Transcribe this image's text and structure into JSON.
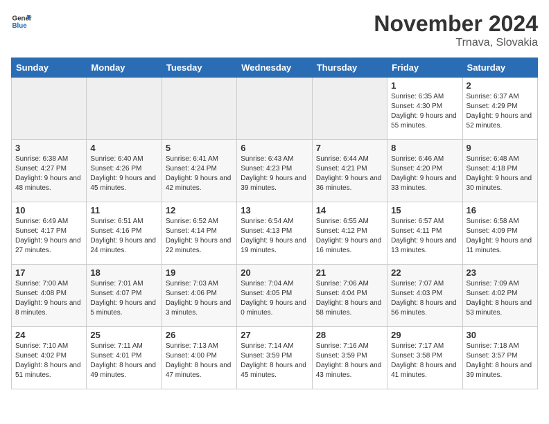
{
  "header": {
    "logo_line1": "General",
    "logo_line2": "Blue",
    "month_title": "November 2024",
    "location": "Trnava, Slovakia"
  },
  "weekdays": [
    "Sunday",
    "Monday",
    "Tuesday",
    "Wednesday",
    "Thursday",
    "Friday",
    "Saturday"
  ],
  "weeks": [
    {
      "days": [
        {
          "num": "",
          "empty": true
        },
        {
          "num": "",
          "empty": true
        },
        {
          "num": "",
          "empty": true
        },
        {
          "num": "",
          "empty": true
        },
        {
          "num": "",
          "empty": true
        },
        {
          "num": "1",
          "sunrise": "6:35 AM",
          "sunset": "4:30 PM",
          "daylight": "9 hours and 55 minutes."
        },
        {
          "num": "2",
          "sunrise": "6:37 AM",
          "sunset": "4:29 PM",
          "daylight": "9 hours and 52 minutes."
        }
      ]
    },
    {
      "days": [
        {
          "num": "3",
          "sunrise": "6:38 AM",
          "sunset": "4:27 PM",
          "daylight": "9 hours and 48 minutes."
        },
        {
          "num": "4",
          "sunrise": "6:40 AM",
          "sunset": "4:26 PM",
          "daylight": "9 hours and 45 minutes."
        },
        {
          "num": "5",
          "sunrise": "6:41 AM",
          "sunset": "4:24 PM",
          "daylight": "9 hours and 42 minutes."
        },
        {
          "num": "6",
          "sunrise": "6:43 AM",
          "sunset": "4:23 PM",
          "daylight": "9 hours and 39 minutes."
        },
        {
          "num": "7",
          "sunrise": "6:44 AM",
          "sunset": "4:21 PM",
          "daylight": "9 hours and 36 minutes."
        },
        {
          "num": "8",
          "sunrise": "6:46 AM",
          "sunset": "4:20 PM",
          "daylight": "9 hours and 33 minutes."
        },
        {
          "num": "9",
          "sunrise": "6:48 AM",
          "sunset": "4:18 PM",
          "daylight": "9 hours and 30 minutes."
        }
      ]
    },
    {
      "days": [
        {
          "num": "10",
          "sunrise": "6:49 AM",
          "sunset": "4:17 PM",
          "daylight": "9 hours and 27 minutes."
        },
        {
          "num": "11",
          "sunrise": "6:51 AM",
          "sunset": "4:16 PM",
          "daylight": "9 hours and 24 minutes."
        },
        {
          "num": "12",
          "sunrise": "6:52 AM",
          "sunset": "4:14 PM",
          "daylight": "9 hours and 22 minutes."
        },
        {
          "num": "13",
          "sunrise": "6:54 AM",
          "sunset": "4:13 PM",
          "daylight": "9 hours and 19 minutes."
        },
        {
          "num": "14",
          "sunrise": "6:55 AM",
          "sunset": "4:12 PM",
          "daylight": "9 hours and 16 minutes."
        },
        {
          "num": "15",
          "sunrise": "6:57 AM",
          "sunset": "4:11 PM",
          "daylight": "9 hours and 13 minutes."
        },
        {
          "num": "16",
          "sunrise": "6:58 AM",
          "sunset": "4:09 PM",
          "daylight": "9 hours and 11 minutes."
        }
      ]
    },
    {
      "days": [
        {
          "num": "17",
          "sunrise": "7:00 AM",
          "sunset": "4:08 PM",
          "daylight": "9 hours and 8 minutes."
        },
        {
          "num": "18",
          "sunrise": "7:01 AM",
          "sunset": "4:07 PM",
          "daylight": "9 hours and 5 minutes."
        },
        {
          "num": "19",
          "sunrise": "7:03 AM",
          "sunset": "4:06 PM",
          "daylight": "9 hours and 3 minutes."
        },
        {
          "num": "20",
          "sunrise": "7:04 AM",
          "sunset": "4:05 PM",
          "daylight": "9 hours and 0 minutes."
        },
        {
          "num": "21",
          "sunrise": "7:06 AM",
          "sunset": "4:04 PM",
          "daylight": "8 hours and 58 minutes."
        },
        {
          "num": "22",
          "sunrise": "7:07 AM",
          "sunset": "4:03 PM",
          "daylight": "8 hours and 56 minutes."
        },
        {
          "num": "23",
          "sunrise": "7:09 AM",
          "sunset": "4:02 PM",
          "daylight": "8 hours and 53 minutes."
        }
      ]
    },
    {
      "days": [
        {
          "num": "24",
          "sunrise": "7:10 AM",
          "sunset": "4:02 PM",
          "daylight": "8 hours and 51 minutes."
        },
        {
          "num": "25",
          "sunrise": "7:11 AM",
          "sunset": "4:01 PM",
          "daylight": "8 hours and 49 minutes."
        },
        {
          "num": "26",
          "sunrise": "7:13 AM",
          "sunset": "4:00 PM",
          "daylight": "8 hours and 47 minutes."
        },
        {
          "num": "27",
          "sunrise": "7:14 AM",
          "sunset": "3:59 PM",
          "daylight": "8 hours and 45 minutes."
        },
        {
          "num": "28",
          "sunrise": "7:16 AM",
          "sunset": "3:59 PM",
          "daylight": "8 hours and 43 minutes."
        },
        {
          "num": "29",
          "sunrise": "7:17 AM",
          "sunset": "3:58 PM",
          "daylight": "8 hours and 41 minutes."
        },
        {
          "num": "30",
          "sunrise": "7:18 AM",
          "sunset": "3:57 PM",
          "daylight": "8 hours and 39 minutes."
        }
      ]
    }
  ]
}
